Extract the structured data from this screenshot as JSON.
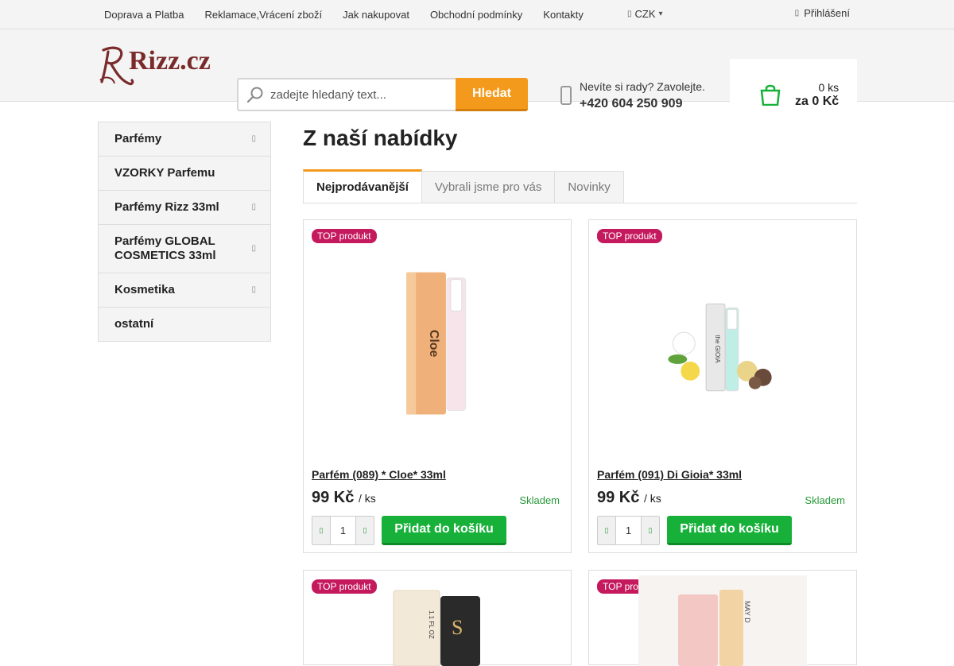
{
  "topbar": {
    "links": [
      "Doprava a Platba",
      "Reklamace,Vrácení zboží",
      "Jak nakupovat",
      "Obchodní podmínky",
      "Kontakty"
    ],
    "currency": "CZK",
    "login": "Přihlášení"
  },
  "header": {
    "logo_text": "Rizz.cz",
    "search": {
      "placeholder": "zadejte hledaný text...",
      "button": "Hledat"
    },
    "help": {
      "line1": "Nevíte si rady? Zavolejte.",
      "phone": "+420 604 250 909"
    },
    "cart": {
      "count": "0 ks",
      "sum": "za 0 Kč"
    }
  },
  "sidebar": {
    "items": [
      {
        "label": "Parfémy",
        "arrow": true
      },
      {
        "label": "VZORKY Parfemu",
        "arrow": false
      },
      {
        "label": "Parfémy Rizz 33ml",
        "arrow": true
      },
      {
        "label": "Parfémy GLOBAL COSMETICS 33ml",
        "arrow": true
      },
      {
        "label": "Kosmetika",
        "arrow": true
      },
      {
        "label": "ostatní",
        "arrow": false
      }
    ]
  },
  "main": {
    "title": "Z naší nabídky",
    "tabs": [
      "Nejprodávanější",
      "Vybrali jsme pro vás",
      "Novinky"
    ],
    "active_tab": 0,
    "products": [
      {
        "badge": "TOP produkt",
        "name": "Parfém (089) * Cloe* 33ml",
        "price": "99 Kč",
        "unit": "/ ks",
        "stock": "Skladem",
        "qty": "1",
        "button": "Přidat do košíku",
        "bottle_label": "Cloe",
        "bottle_color": "#f0b07a"
      },
      {
        "badge": "TOP produkt",
        "name": "Parfém (091) Di Gioia* 33ml",
        "price": "99 Kč",
        "unit": "/ ks",
        "stock": "Skladem",
        "qty": "1",
        "button": "Přidat do košíku",
        "bottle_label": "the GIOIA",
        "bottle_color": "#e8e8e8"
      },
      {
        "badge": "TOP produkt",
        "bottle_label": "1.1 FL OZ",
        "bottle_color": "#f3e9d8"
      },
      {
        "badge": "TOP produkt",
        "bottle_label": "MAY D",
        "bottle_color": "#f3c7c4"
      }
    ]
  },
  "colors": {
    "accent": "#f39a1c",
    "add_button": "#17b13a",
    "badge": "#c5195e",
    "stock": "#2a9a3a"
  }
}
